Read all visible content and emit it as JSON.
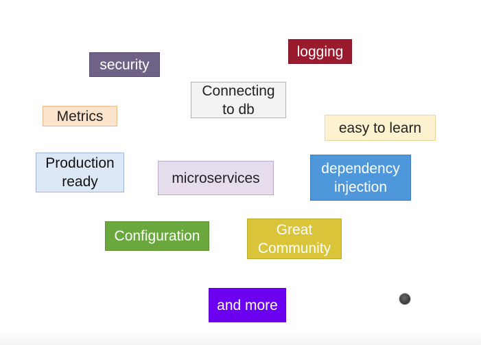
{
  "tags": {
    "security": "security",
    "logging": "logging",
    "connecting_line1": "Connecting",
    "connecting_line2": "to db",
    "metrics": "Metrics",
    "easy": "easy to learn",
    "production_line1": "Production",
    "production_line2": "ready",
    "microservices": "microservices",
    "dependency_line1": "dependency",
    "dependency_line2": "injection",
    "configuration": "Configuration",
    "community_line1": "Great",
    "community_line2": "Community",
    "more": "and more"
  },
  "colors": {
    "security": "#6f6287",
    "logging": "#9b1b2e",
    "connecting": "#f3f3f3",
    "metrics": "#fbe3cc",
    "easy": "#fcf2cf",
    "production": "#dde8f7",
    "microservices": "#e5dcec",
    "dependency": "#4d97da",
    "configuration": "#6aa83e",
    "community": "#d9c43a",
    "more": "#6c00f0"
  }
}
